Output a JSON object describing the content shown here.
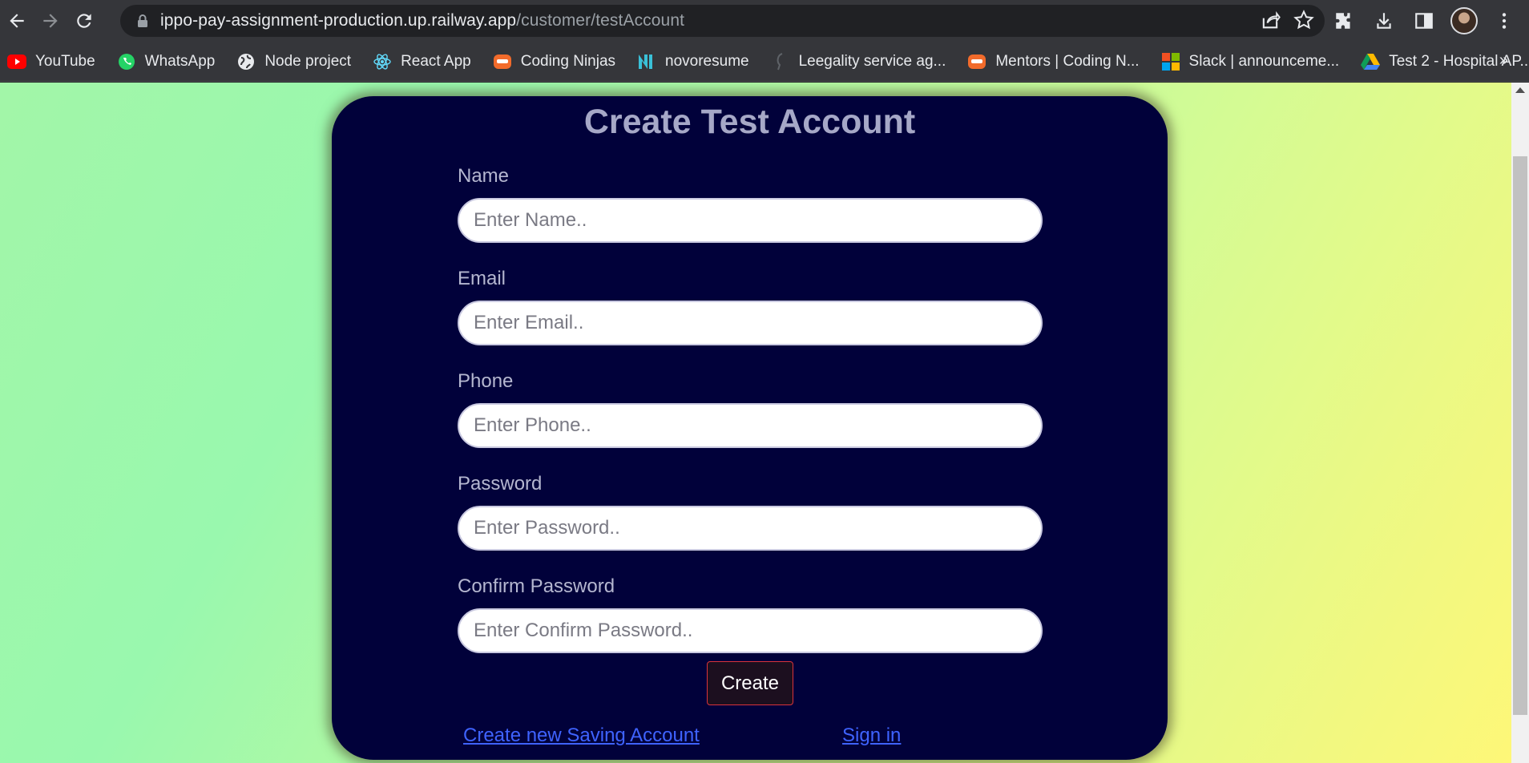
{
  "browser": {
    "url_host": "ippo-pay-assignment-production.up.railway.app",
    "url_path": "/customer/testAccount",
    "bookmarks": [
      {
        "label": "YouTube",
        "icon": "youtube-icon"
      },
      {
        "label": "WhatsApp",
        "icon": "whatsapp-icon"
      },
      {
        "label": "Node project",
        "icon": "globe-icon"
      },
      {
        "label": "React App",
        "icon": "react-icon"
      },
      {
        "label": "Coding Ninjas",
        "icon": "coding-ninjas-icon"
      },
      {
        "label": "novoresume",
        "icon": "novoresume-icon"
      },
      {
        "label": "Leegality service ag...",
        "icon": "leegality-icon"
      },
      {
        "label": "Mentors | Coding N...",
        "icon": "coding-ninjas-icon"
      },
      {
        "label": "Slack | announceme...",
        "icon": "microsoft-icon"
      },
      {
        "label": "Test 2 - Hospital AP...",
        "icon": "google-drive-icon"
      }
    ],
    "more_label": "»"
  },
  "form": {
    "title": "Create Test Account",
    "fields": [
      {
        "label": "Name",
        "placeholder": "Enter Name..",
        "value": ""
      },
      {
        "label": "Email",
        "placeholder": "Enter Email..",
        "value": ""
      },
      {
        "label": "Phone",
        "placeholder": "Enter Phone..",
        "value": ""
      },
      {
        "label": "Password",
        "placeholder": "Enter Password..",
        "value": ""
      },
      {
        "label": "Confirm Password",
        "placeholder": "Enter Confirm Password..",
        "value": ""
      }
    ],
    "submit_label": "Create",
    "links": {
      "create_saving": "Create new Saving Account",
      "sign_in": "Sign in"
    }
  },
  "colors": {
    "card_bg": "#01013a",
    "title": "#a6a8c7",
    "link": "#3f63ff",
    "button_border": "#d9343b"
  }
}
